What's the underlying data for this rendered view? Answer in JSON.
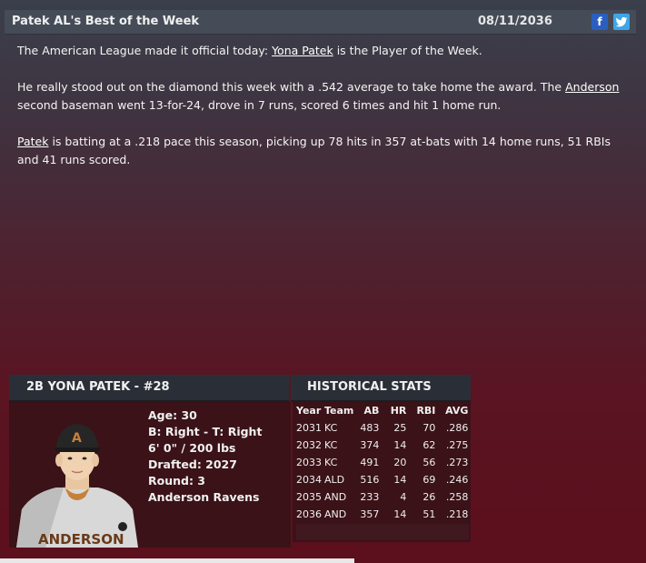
{
  "header": {
    "title": "Patek AL's Best of the Week",
    "date": "08/11/2036",
    "facebook_icon": "f",
    "twitter_icon": "twitter-bird"
  },
  "article": {
    "p1_before": "The American League made it official today: ",
    "p1_link": "Yona Patek",
    "p1_after": " is the Player of the Week.",
    "p2_before": "He really stood out on the diamond this week with a .542 average to take home the award. The ",
    "p2_link": "Anderson",
    "p2_after": " second baseman went 13-for-24, drove in 7 runs, scored 6 times and hit 1 home run.",
    "p3_link": "Patek",
    "p3_after": " is batting at a .218 pace this season, picking up 78 hits in 357 at-bats with 14 home runs, 51 RBIs and 41 runs scored."
  },
  "player": {
    "header": "2B YONA PATEK - #28",
    "age": "Age: 30",
    "bats_throws": "B: Right - T: Right",
    "size": "6' 0\" / 200 lbs",
    "drafted": "Drafted: 2027",
    "round": "Round: 3",
    "team": "Anderson Ravens",
    "cap_letter": "A",
    "jersey_text": "ANDERSON"
  },
  "historical": {
    "header": "HISTORICAL STATS",
    "columns": [
      "Year",
      "Team",
      "AB",
      "HR",
      "RBI",
      "AVG"
    ],
    "rows": [
      [
        "2031",
        "KC",
        "483",
        "25",
        "70",
        ".286"
      ],
      [
        "2032",
        "KC",
        "374",
        "14",
        "62",
        ".275"
      ],
      [
        "2033",
        "KC",
        "491",
        "20",
        "56",
        ".273"
      ],
      [
        "2034",
        "ALD",
        "516",
        "14",
        "69",
        ".246"
      ],
      [
        "2035",
        "AND",
        "233",
        "4",
        "26",
        ".258"
      ],
      [
        "2036",
        "AND",
        "357",
        "14",
        "51",
        ".218"
      ]
    ]
  },
  "colors": {
    "accent_facebook": "#2a5fc0",
    "accent_twitter": "#3ea5e6",
    "jersey_orange": "#c7803a"
  }
}
